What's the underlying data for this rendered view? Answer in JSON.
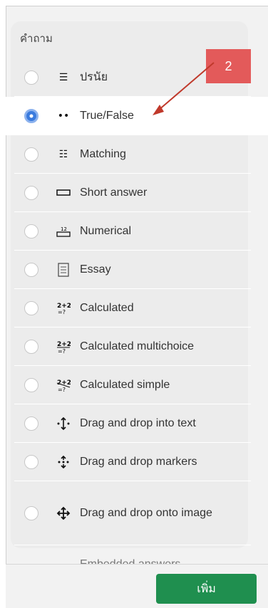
{
  "section_label": "คำถาม",
  "callout_badge": "2",
  "options": [
    {
      "label": "ปรนัย",
      "icon": "list-icon",
      "selected": false
    },
    {
      "label": "True/False",
      "icon": "two-dots-icon",
      "selected": true
    },
    {
      "label": "Matching",
      "icon": "matching-list-icon",
      "selected": false
    },
    {
      "label": "Short answer",
      "icon": "short-answer-box-icon",
      "selected": false
    },
    {
      "label": "Numerical",
      "icon": "numerical-icon",
      "selected": false
    },
    {
      "label": "Essay",
      "icon": "essay-document-icon",
      "selected": false
    },
    {
      "label": "Calculated",
      "icon": "calculated-icon",
      "selected": false
    },
    {
      "label": "Calculated multichoice",
      "icon": "calculated-multichoice-icon",
      "selected": false
    },
    {
      "label": "Calculated simple",
      "icon": "calculated-simple-icon",
      "selected": false
    },
    {
      "label": "Drag and drop into text",
      "icon": "drag-into-text-icon",
      "selected": false
    },
    {
      "label": "Drag and drop markers",
      "icon": "drag-markers-icon",
      "selected": false
    },
    {
      "label": "Drag and drop onto image",
      "icon": "drag-onto-image-icon",
      "selected": false
    }
  ],
  "partially_visible_option": "Embedded answers",
  "add_button_label": "เพิ่ม",
  "colors": {
    "badge": "#e35a5a",
    "arrow": "#c0392b",
    "radio_selected": "#3a7bde",
    "add_button": "#1f8f4f"
  }
}
